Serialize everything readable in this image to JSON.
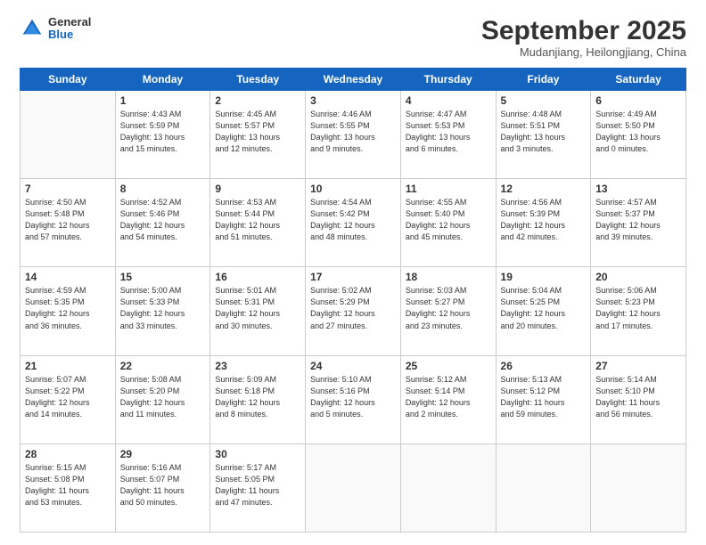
{
  "logo": {
    "general": "General",
    "blue": "Blue"
  },
  "title": "September 2025",
  "subtitle": "Mudanjiang, Heilongjiang, China",
  "days_of_week": [
    "Sunday",
    "Monday",
    "Tuesday",
    "Wednesday",
    "Thursday",
    "Friday",
    "Saturday"
  ],
  "weeks": [
    [
      {
        "day": "",
        "info": ""
      },
      {
        "day": "1",
        "info": "Sunrise: 4:43 AM\nSunset: 5:59 PM\nDaylight: 13 hours\nand 15 minutes."
      },
      {
        "day": "2",
        "info": "Sunrise: 4:45 AM\nSunset: 5:57 PM\nDaylight: 13 hours\nand 12 minutes."
      },
      {
        "day": "3",
        "info": "Sunrise: 4:46 AM\nSunset: 5:55 PM\nDaylight: 13 hours\nand 9 minutes."
      },
      {
        "day": "4",
        "info": "Sunrise: 4:47 AM\nSunset: 5:53 PM\nDaylight: 13 hours\nand 6 minutes."
      },
      {
        "day": "5",
        "info": "Sunrise: 4:48 AM\nSunset: 5:51 PM\nDaylight: 13 hours\nand 3 minutes."
      },
      {
        "day": "6",
        "info": "Sunrise: 4:49 AM\nSunset: 5:50 PM\nDaylight: 13 hours\nand 0 minutes."
      }
    ],
    [
      {
        "day": "7",
        "info": "Sunrise: 4:50 AM\nSunset: 5:48 PM\nDaylight: 12 hours\nand 57 minutes."
      },
      {
        "day": "8",
        "info": "Sunrise: 4:52 AM\nSunset: 5:46 PM\nDaylight: 12 hours\nand 54 minutes."
      },
      {
        "day": "9",
        "info": "Sunrise: 4:53 AM\nSunset: 5:44 PM\nDaylight: 12 hours\nand 51 minutes."
      },
      {
        "day": "10",
        "info": "Sunrise: 4:54 AM\nSunset: 5:42 PM\nDaylight: 12 hours\nand 48 minutes."
      },
      {
        "day": "11",
        "info": "Sunrise: 4:55 AM\nSunset: 5:40 PM\nDaylight: 12 hours\nand 45 minutes."
      },
      {
        "day": "12",
        "info": "Sunrise: 4:56 AM\nSunset: 5:39 PM\nDaylight: 12 hours\nand 42 minutes."
      },
      {
        "day": "13",
        "info": "Sunrise: 4:57 AM\nSunset: 5:37 PM\nDaylight: 12 hours\nand 39 minutes."
      }
    ],
    [
      {
        "day": "14",
        "info": "Sunrise: 4:59 AM\nSunset: 5:35 PM\nDaylight: 12 hours\nand 36 minutes."
      },
      {
        "day": "15",
        "info": "Sunrise: 5:00 AM\nSunset: 5:33 PM\nDaylight: 12 hours\nand 33 minutes."
      },
      {
        "day": "16",
        "info": "Sunrise: 5:01 AM\nSunset: 5:31 PM\nDaylight: 12 hours\nand 30 minutes."
      },
      {
        "day": "17",
        "info": "Sunrise: 5:02 AM\nSunset: 5:29 PM\nDaylight: 12 hours\nand 27 minutes."
      },
      {
        "day": "18",
        "info": "Sunrise: 5:03 AM\nSunset: 5:27 PM\nDaylight: 12 hours\nand 23 minutes."
      },
      {
        "day": "19",
        "info": "Sunrise: 5:04 AM\nSunset: 5:25 PM\nDaylight: 12 hours\nand 20 minutes."
      },
      {
        "day": "20",
        "info": "Sunrise: 5:06 AM\nSunset: 5:23 PM\nDaylight: 12 hours\nand 17 minutes."
      }
    ],
    [
      {
        "day": "21",
        "info": "Sunrise: 5:07 AM\nSunset: 5:22 PM\nDaylight: 12 hours\nand 14 minutes."
      },
      {
        "day": "22",
        "info": "Sunrise: 5:08 AM\nSunset: 5:20 PM\nDaylight: 12 hours\nand 11 minutes."
      },
      {
        "day": "23",
        "info": "Sunrise: 5:09 AM\nSunset: 5:18 PM\nDaylight: 12 hours\nand 8 minutes."
      },
      {
        "day": "24",
        "info": "Sunrise: 5:10 AM\nSunset: 5:16 PM\nDaylight: 12 hours\nand 5 minutes."
      },
      {
        "day": "25",
        "info": "Sunrise: 5:12 AM\nSunset: 5:14 PM\nDaylight: 12 hours\nand 2 minutes."
      },
      {
        "day": "26",
        "info": "Sunrise: 5:13 AM\nSunset: 5:12 PM\nDaylight: 11 hours\nand 59 minutes."
      },
      {
        "day": "27",
        "info": "Sunrise: 5:14 AM\nSunset: 5:10 PM\nDaylight: 11 hours\nand 56 minutes."
      }
    ],
    [
      {
        "day": "28",
        "info": "Sunrise: 5:15 AM\nSunset: 5:08 PM\nDaylight: 11 hours\nand 53 minutes."
      },
      {
        "day": "29",
        "info": "Sunrise: 5:16 AM\nSunset: 5:07 PM\nDaylight: 11 hours\nand 50 minutes."
      },
      {
        "day": "30",
        "info": "Sunrise: 5:17 AM\nSunset: 5:05 PM\nDaylight: 11 hours\nand 47 minutes."
      },
      {
        "day": "",
        "info": ""
      },
      {
        "day": "",
        "info": ""
      },
      {
        "day": "",
        "info": ""
      },
      {
        "day": "",
        "info": ""
      }
    ]
  ]
}
